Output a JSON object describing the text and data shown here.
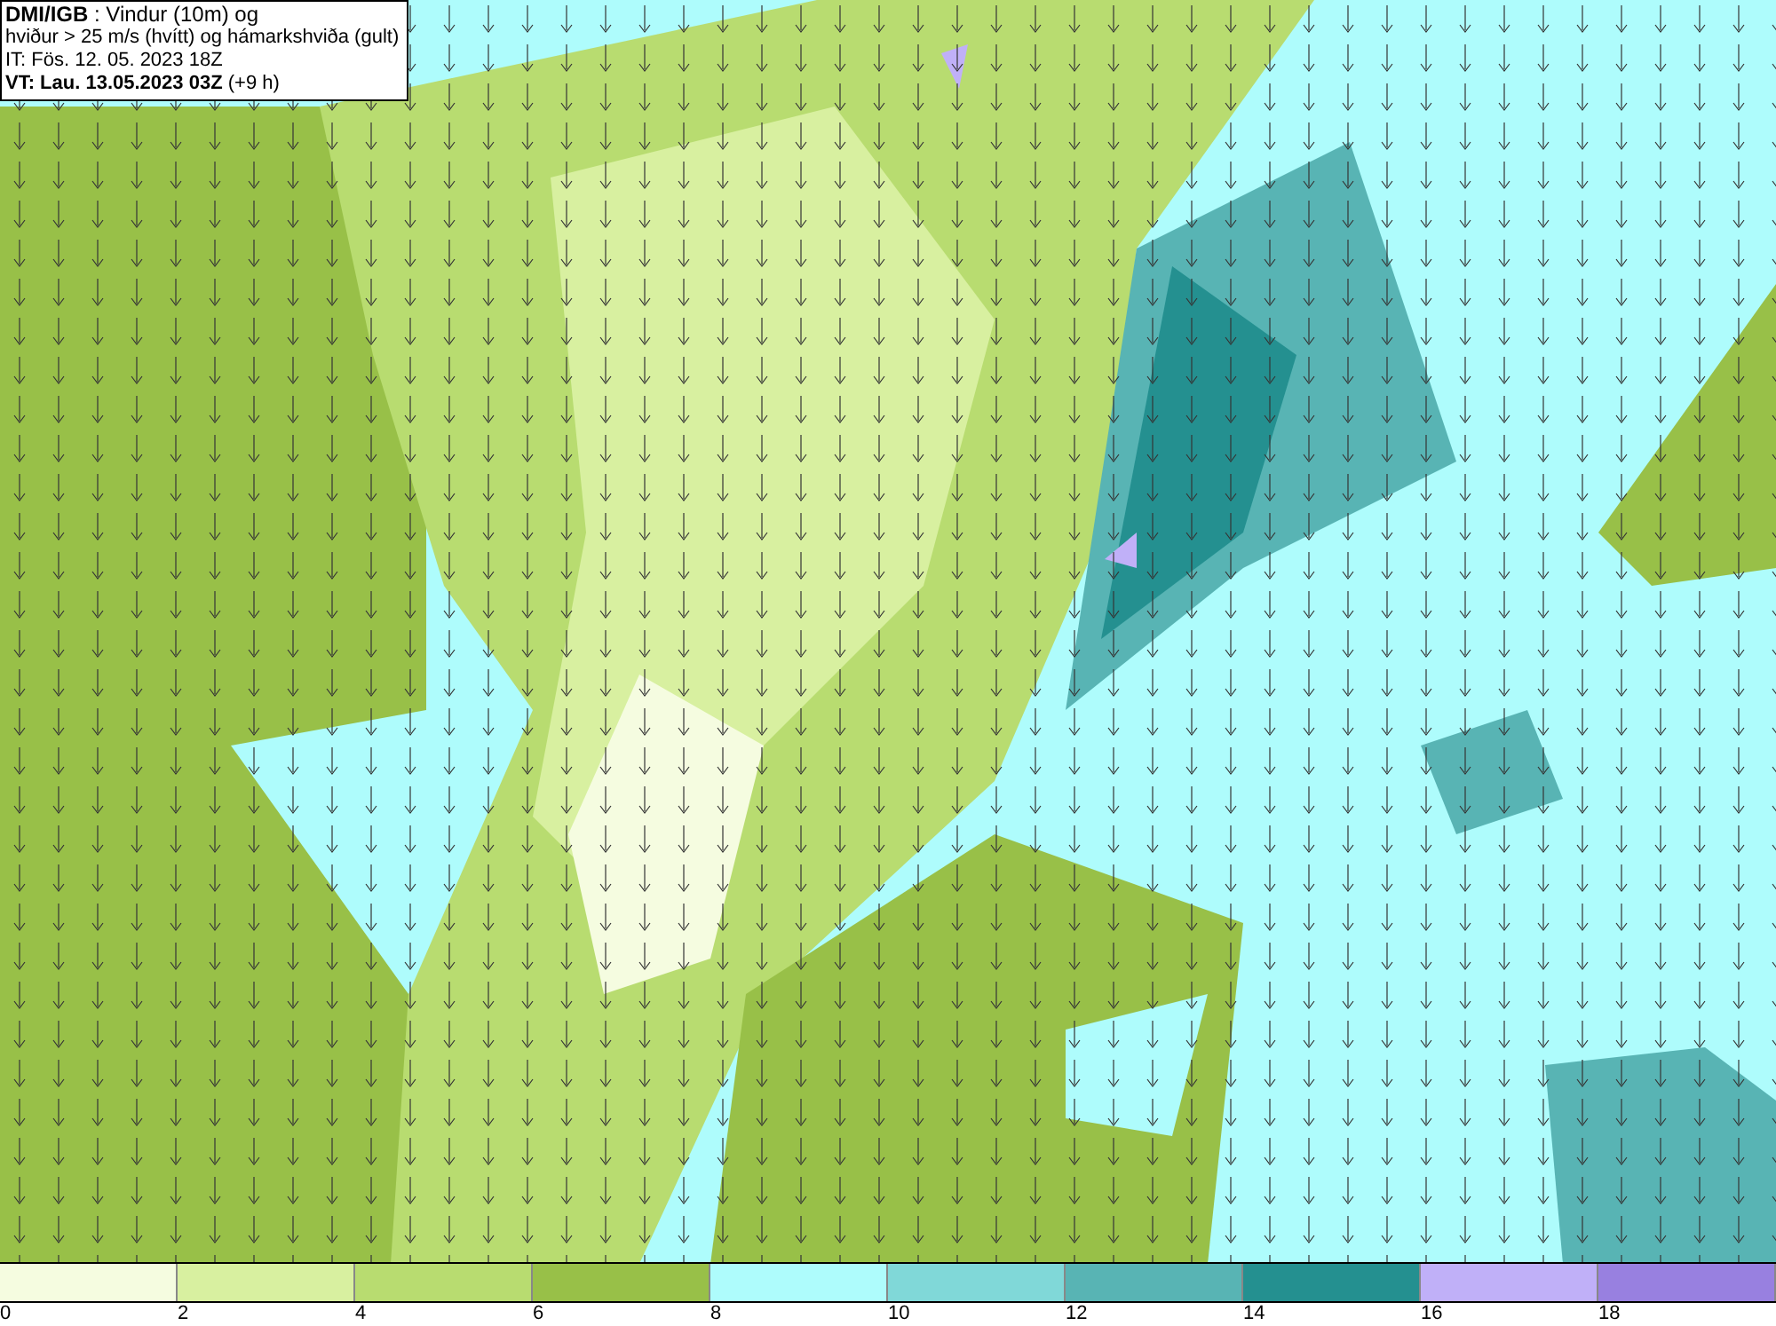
{
  "legend": {
    "lines": [
      "**DMI/IGB** : Vindur (10m) og",
      "hviður > 25 m/s (hvítt) og hámarkshviða (gult)",
      "IT: Fös. 12. 05. 2023 18Z",
      "**VT: Lau. 13.05.2023 03Z** (+9 h)"
    ]
  },
  "colorbar": {
    "segments": [
      {
        "color": "#f5fce0"
      },
      {
        "color": "#d8f0a0"
      },
      {
        "color": "#b8dc70"
      },
      {
        "color": "#98c048"
      },
      {
        "color": "#aefcfc"
      },
      {
        "color": "#80d8d8"
      },
      {
        "color": "#58b4b4"
      },
      {
        "color": "#249090"
      },
      {
        "color": "#c0b0f8"
      },
      {
        "color": "#9880e0"
      }
    ],
    "ticks": [
      "0",
      "2",
      "4",
      "6",
      "8",
      "10",
      "12",
      "14",
      "16",
      "18"
    ]
  }
}
